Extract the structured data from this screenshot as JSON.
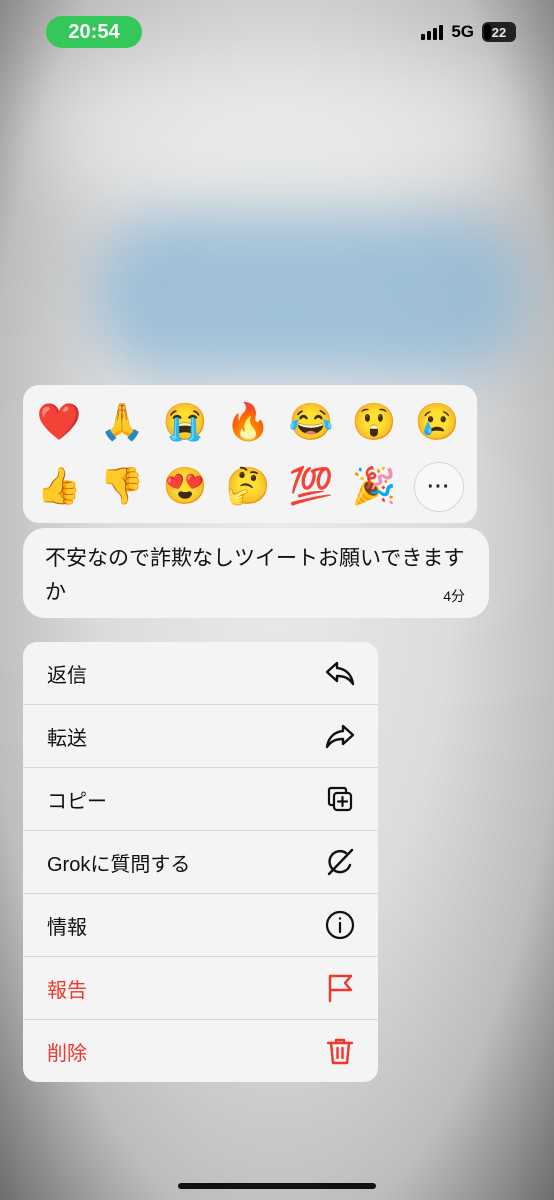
{
  "status_bar": {
    "time": "20:54",
    "network": "5G",
    "battery": "22"
  },
  "reactions": {
    "row1": [
      "❤️",
      "🙏",
      "😭",
      "🔥",
      "😂",
      "😲",
      "😢"
    ],
    "row2": [
      "👍",
      "👎",
      "😍",
      "🤔",
      "💯",
      "🎉"
    ],
    "more": "···"
  },
  "message": {
    "text": "不安なので詐欺なしツイートお願いできますか",
    "time": "4分"
  },
  "menu": {
    "items": [
      {
        "label": "返信",
        "icon": "reply-icon"
      },
      {
        "label": "転送",
        "icon": "forward-icon"
      },
      {
        "label": "コピー",
        "icon": "copy-icon"
      },
      {
        "label": "Grokに質問する",
        "icon": "grok-icon"
      },
      {
        "label": "情報",
        "icon": "info-icon"
      },
      {
        "label": "報告",
        "icon": "flag-icon"
      },
      {
        "label": "削除",
        "icon": "trash-icon"
      }
    ],
    "danger_color": "#f0362c"
  }
}
